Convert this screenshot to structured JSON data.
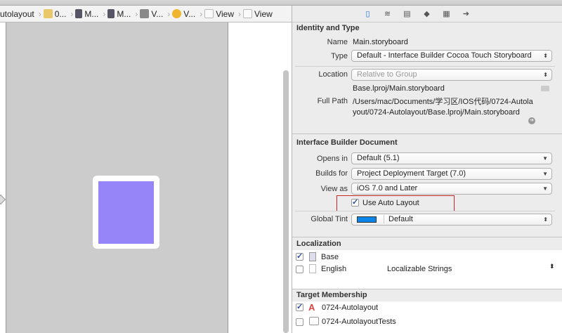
{
  "breadcrumb": [
    "utolayout",
    "0...",
    "M...",
    "M...",
    "V...",
    "V...",
    "View",
    "View"
  ],
  "inspector": {
    "tabs": [
      "file-inspector",
      "quick-help",
      "identity",
      "attributes",
      "size",
      "connections"
    ],
    "identity": {
      "title": "Identity and Type",
      "name_label": "Name",
      "name": "Main.storyboard",
      "type_label": "Type",
      "type": "Default - Interface Builder Cocoa Touch Storyboard",
      "location_label": "Location",
      "location": "Relative to Group",
      "relative_path": "Base.lproj/Main.storyboard",
      "full_path_label": "Full Path",
      "full_path": "/Users/mac/Documents/学习区/IOS代码/0724-Autolayout/0724-Autolayout/Base.lproj/Main.storyboard"
    },
    "ibdoc": {
      "title": "Interface Builder Document",
      "opens_in_label": "Opens in",
      "opens_in": "Default (5.1)",
      "builds_for_label": "Builds for",
      "builds_for": "Project Deployment Target (7.0)",
      "view_as_label": "View as",
      "view_as": "iOS 7.0 and Later",
      "auto_layout": "Use Auto Layout",
      "auto_layout_checked": true,
      "tint_label": "Global Tint",
      "tint": "Default",
      "tint_color": "#0a84e8"
    },
    "localization": {
      "title": "Localization",
      "items": [
        {
          "name": "Base",
          "checked": true,
          "type": ""
        },
        {
          "name": "English",
          "checked": false,
          "type": "Localizable Strings"
        }
      ]
    },
    "target": {
      "title": "Target Membership",
      "items": [
        {
          "name": "0724-Autolayout",
          "checked": true
        },
        {
          "name": "0724-AutolayoutTests",
          "checked": false
        }
      ]
    }
  },
  "colors": {
    "view_fill": "#9684f9",
    "highlight": "#cc2222"
  }
}
